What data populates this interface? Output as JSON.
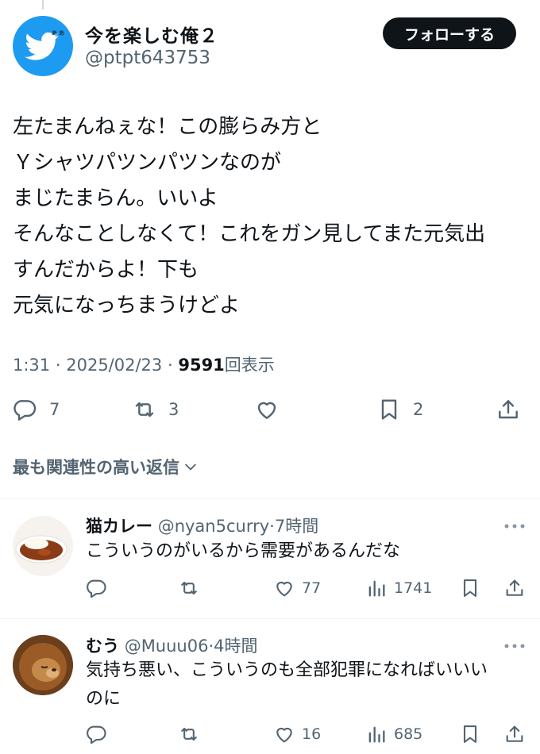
{
  "author": {
    "name": "今を楽しむ俺２",
    "handle": "@ptpt643753",
    "follow_label": "フォローする",
    "brand_color": "#1d9bf0"
  },
  "tweet": {
    "lines": [
      "左たまんねぇな！この膨らみ方と",
      "Ｙシャツパツンパツンなのが",
      "まじたまらん。いいよ",
      "そんなことしなくて！これをガン見してまた元気出",
      "すんだからよ！下も",
      "元気になっちまうけどよ"
    ],
    "time": "1:31",
    "sep": "·",
    "date": "2025/02/23",
    "views": "9591",
    "views_label": "回表示",
    "replies": "7",
    "retweets": "3",
    "bookmarks": "2"
  },
  "sort_label": "最も関連性の高い返信",
  "replies": [
    {
      "name": "猫カレー",
      "handle": "@nyan5curry",
      "sep": "·",
      "time": "7時間",
      "text_lines": [
        "こういうのがいるから需要があるんだな"
      ],
      "likes": "77",
      "views": "1741"
    },
    {
      "name": "むう",
      "handle": "@Muuu06",
      "sep": "·",
      "time": "4時間",
      "text_lines": [
        "気持ち悪い、こういうのも全部犯罪になればいいい",
        "のに"
      ],
      "likes": "16",
      "views": "685"
    }
  ]
}
